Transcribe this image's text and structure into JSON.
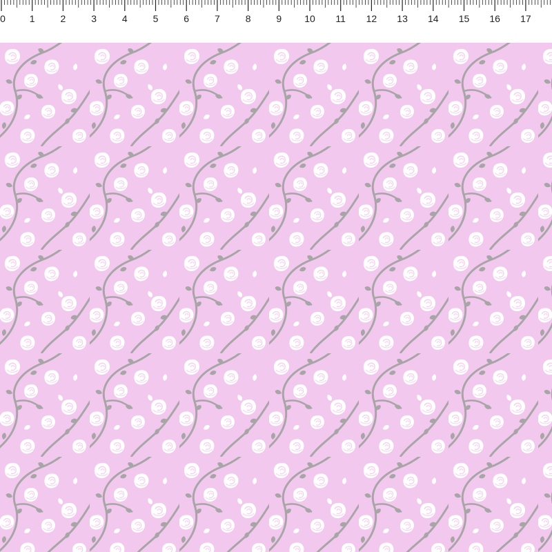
{
  "image": {
    "subject": "fabric swatch with white rose print beside a measuring ruler",
    "colors": {
      "fabric_background": "#f2c8ee",
      "rose": "#ffffff",
      "rose_detail": "#f4d2ef",
      "leaf_vine": "#a8a5a7",
      "ruler": "#ffffff",
      "ruler_marks": "#222222"
    }
  },
  "ruler": {
    "unit": "cm",
    "labels": [
      "0",
      "1",
      "2",
      "3",
      "4",
      "5",
      "6",
      "7",
      "8",
      "9",
      "10",
      "11",
      "12",
      "13",
      "14",
      "15",
      "16",
      "17",
      "1"
    ]
  },
  "pattern": {
    "motif": "rose-vine",
    "icons": [
      "rose-icon",
      "leaf-icon",
      "vine-icon"
    ]
  }
}
